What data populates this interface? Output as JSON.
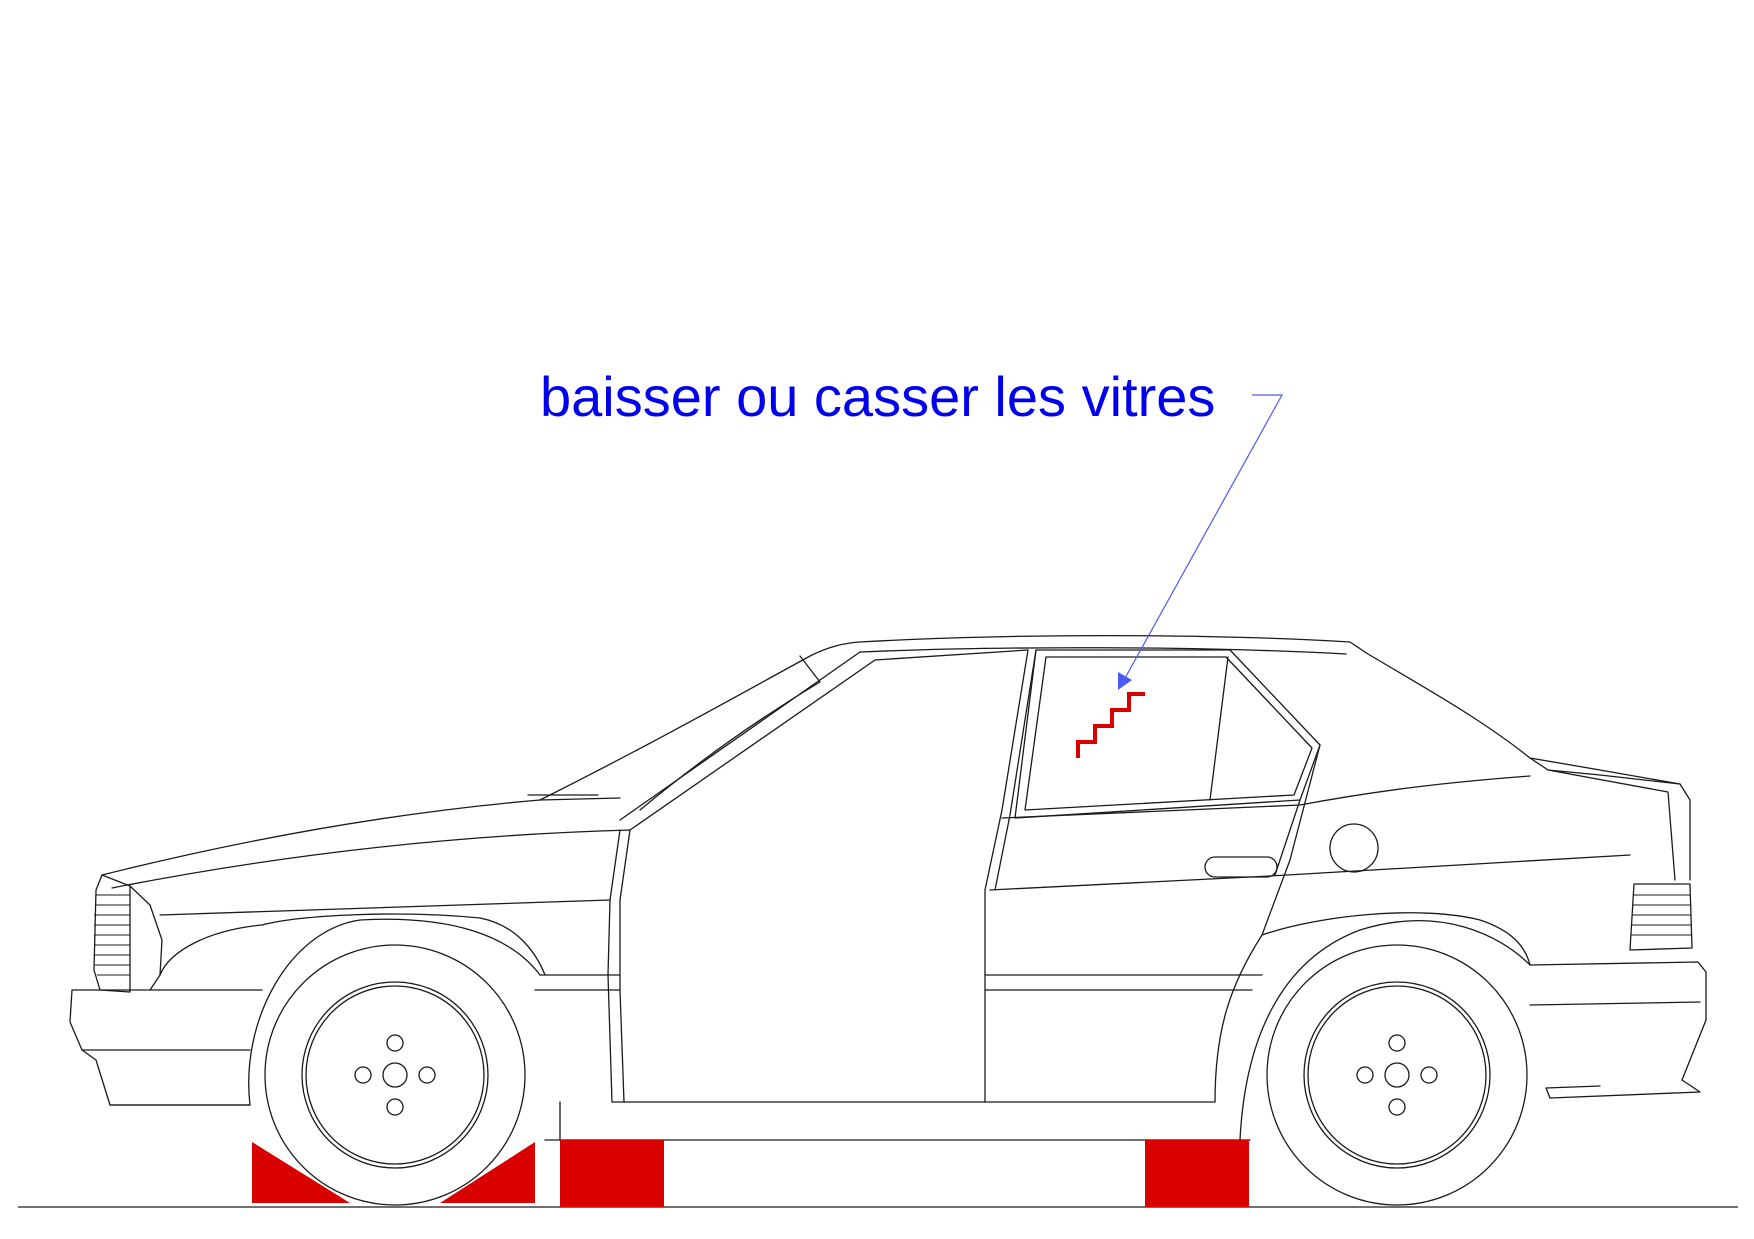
{
  "annotation": {
    "text": "baisser ou casser les vitres"
  },
  "colors": {
    "annotation": "#0000ee",
    "leader": "#4a5cf0",
    "marker": "#d90000",
    "outline": "#1a1a1a",
    "background": "#ffffff"
  },
  "icons": {
    "glass_mark": "zigzag-break-mark"
  }
}
